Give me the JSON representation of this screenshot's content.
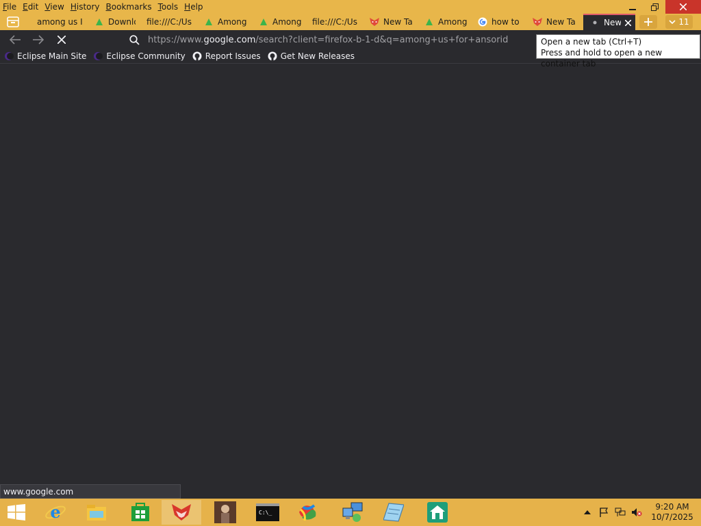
{
  "menu": [
    {
      "label": "File"
    },
    {
      "label": "Edit"
    },
    {
      "label": "View"
    },
    {
      "label": "History"
    },
    {
      "label": "Bookmarks"
    },
    {
      "label": "Tools"
    },
    {
      "label": "Help"
    }
  ],
  "tabs": [
    {
      "title": "among us I",
      "icon": "page-icon"
    },
    {
      "title": "Downlo",
      "icon": "green-triangle-icon"
    },
    {
      "title": "file:///C:/Us",
      "icon": "none"
    },
    {
      "title": "Among",
      "icon": "green-triangle-icon"
    },
    {
      "title": "Among",
      "icon": "green-triangle-icon"
    },
    {
      "title": "file:///C:/Us",
      "icon": "none"
    },
    {
      "title": "New Ta",
      "icon": "fox-icon"
    },
    {
      "title": "Among",
      "icon": "green-triangle-icon"
    },
    {
      "title": "how to",
      "icon": "google-icon"
    },
    {
      "title": "New Ta",
      "icon": "fox-icon"
    },
    {
      "title": "New",
      "icon": "dot-icon",
      "active": true
    }
  ],
  "tab_count": "11",
  "url": {
    "prefix": "https://www.",
    "host": "google.com",
    "rest": "/search?client=firefox-b-1-d&q=among+us+for+ansorid"
  },
  "bookmarks": [
    {
      "label": "Eclipse Main Site",
      "icon": "eclipse-icon"
    },
    {
      "label": "Eclipse Community",
      "icon": "eclipse-icon"
    },
    {
      "label": "Report Issues",
      "icon": "github-icon"
    },
    {
      "label": "Get New Releases",
      "icon": "github-icon"
    }
  ],
  "tooltip": {
    "line1": "Open a new tab (Ctrl+T)",
    "line2": "Press and hold to open a new container tab"
  },
  "status": "www.google.com",
  "clock": {
    "time": "9:20 AM",
    "date": "10/7/2025"
  },
  "colors": {
    "chrome": "#e8b64a",
    "content_bg": "#2a2a2e",
    "active_tab_accent": "#e05a6a",
    "close_button": "#c9342a"
  }
}
